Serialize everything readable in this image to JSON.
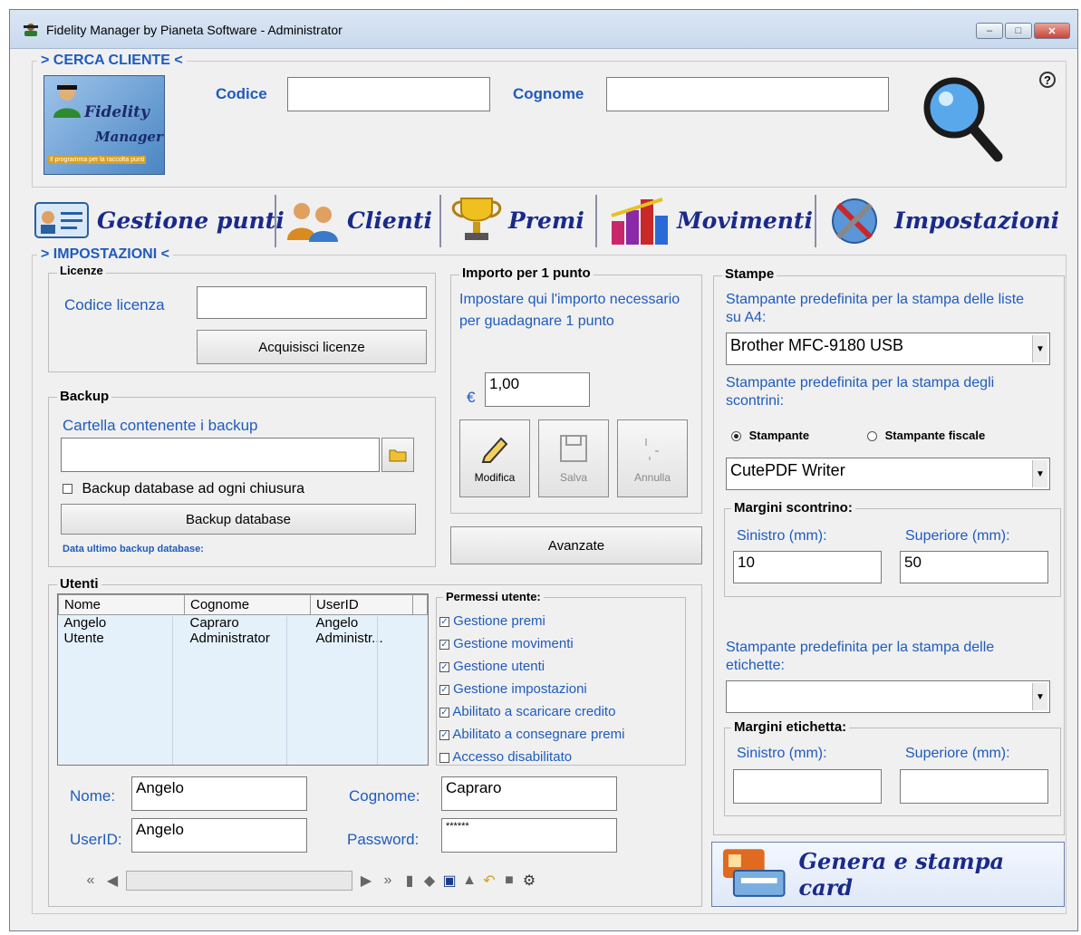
{
  "window": {
    "title": "Fidelity Manager by Pianeta Software - Administrator",
    "minimize": "‒",
    "maximize": "□",
    "close": "✕"
  },
  "search": {
    "header": "> CERCA CLIENTE <",
    "logo_line1": "Fidelity",
    "logo_line2": "Manager",
    "logo_tagline": "Il programma per la raccolta punti",
    "codice_label": "Codice",
    "codice_value": "",
    "cognome_label": "Cognome",
    "cognome_value": "",
    "help": "?"
  },
  "nav": [
    {
      "label": "Gestione punti",
      "icon": "card-icon"
    },
    {
      "label": "Clienti",
      "icon": "people-icon"
    },
    {
      "label": "Premi",
      "icon": "trophy-icon"
    },
    {
      "label": "Movimenti",
      "icon": "chart-icon"
    },
    {
      "label": "Impostazioni",
      "icon": "tools-globe-icon"
    }
  ],
  "settings": {
    "header": "> IMPOSTAZIONI <",
    "licenze": {
      "title": "Licenze",
      "codice_label": "Codice licenza",
      "codice_value": "",
      "button": "Acquisisci licenze"
    },
    "backup": {
      "title": "Backup",
      "folder_label": "Cartella contenente i backup",
      "folder_value": "",
      "checkbox": "Backup database ad ogni chiusura",
      "button": "Backup database",
      "last": "Data ultimo backup database:"
    },
    "importo": {
      "title": "Importo per 1 punto",
      "desc": "Impostare qui l'importo necessario per guadagnare 1 punto",
      "currency": "€",
      "value": "1,00",
      "modifica": "Modifica",
      "salva": "Salva",
      "annulla": "Annulla",
      "avanzate": "Avanzate"
    },
    "stampe": {
      "title": "Stampe",
      "a4_label": "Stampante predefinita per la stampa delle liste su A4:",
      "a4_value": "Brother MFC-9180 USB",
      "scontrini_label": "Stampante predefinita per la stampa degli scontrini:",
      "radio1": "Stampante",
      "radio2": "Stampante fiscale",
      "scontrini_value": "CutePDF Writer",
      "margini_scontrino": {
        "title": "Margini scontrino:",
        "sinistro_label": "Sinistro (mm):",
        "sinistro_value": "10",
        "superiore_label": "Superiore (mm):",
        "superiore_value": "50"
      },
      "etichette_label": "Stampante predefinita per la stampa delle etichette:",
      "etichette_value": "",
      "margini_etichetta": {
        "title": "Margini etichetta:",
        "sinistro_label": "Sinistro (mm):",
        "sinistro_value": "",
        "superiore_label": "Superiore (mm):",
        "superiore_value": ""
      }
    },
    "utenti": {
      "title": "Utenti",
      "columns": [
        "Nome",
        "Cognome",
        "UserID"
      ],
      "rows": [
        [
          "Angelo",
          "Capraro",
          "Angelo"
        ],
        [
          "Utente",
          "Administrator",
          "Administr..."
        ]
      ],
      "permessi_title": "Permessi utente:",
      "permessi": [
        {
          "label": "Gestione premi",
          "checked": true
        },
        {
          "label": "Gestione movimenti",
          "checked": true
        },
        {
          "label": "Gestione utenti",
          "checked": true
        },
        {
          "label": "Gestione impostazioni",
          "checked": true
        },
        {
          "label": "Abilitato a scaricare credito",
          "checked": true
        },
        {
          "label": "Abilitato a consegnare premi",
          "checked": true
        },
        {
          "label": "Accesso disabilitato",
          "checked": false
        }
      ],
      "nome_label": "Nome:",
      "nome_value": "Angelo",
      "cognome_label": "Cognome:",
      "cognome_value": "Capraro",
      "userid_label": "UserID:",
      "userid_value": "Angelo",
      "password_label": "Password:",
      "password_value": "******"
    },
    "genera_card": "Genera e stampa card"
  }
}
